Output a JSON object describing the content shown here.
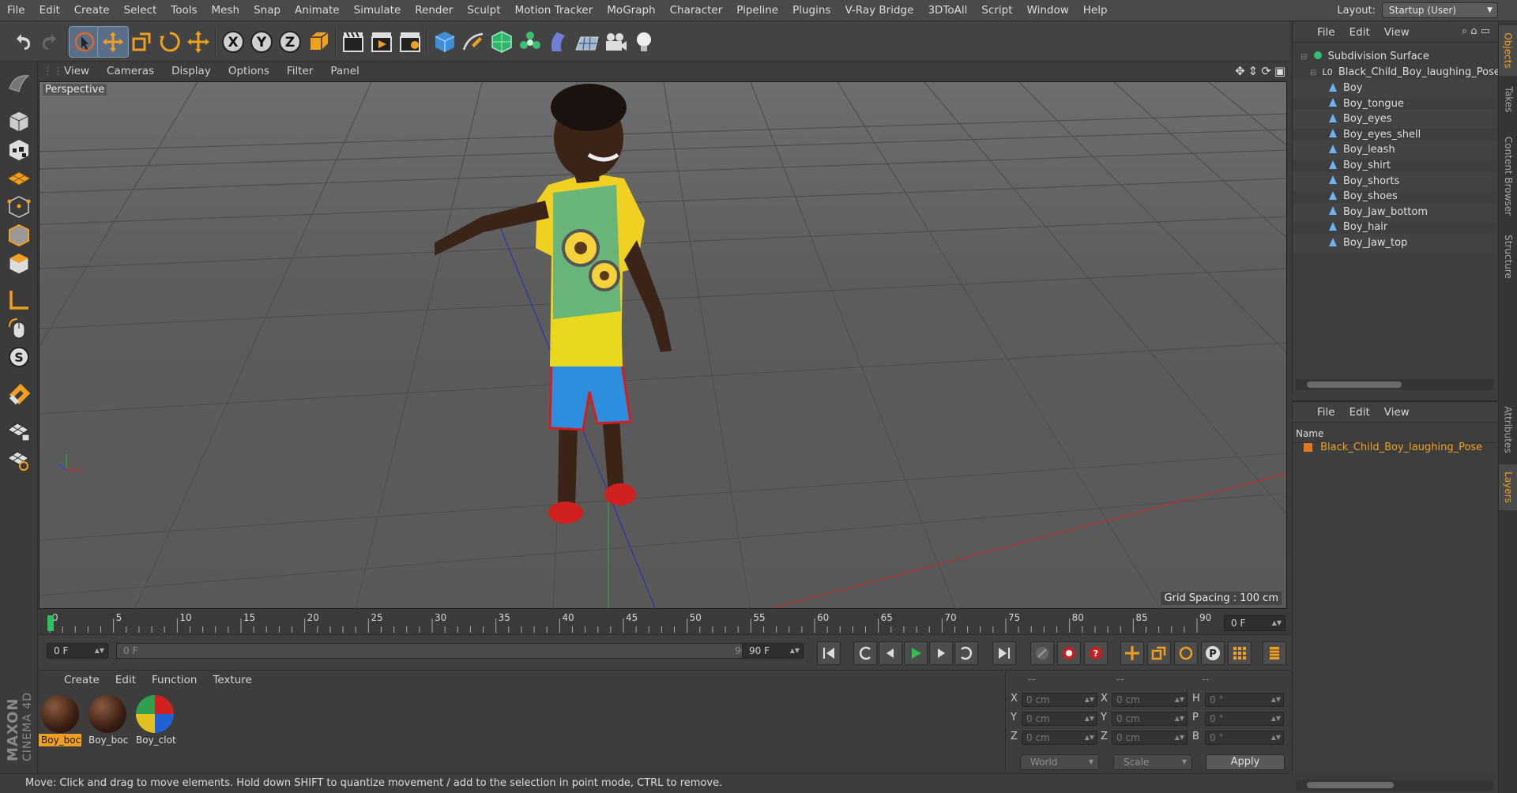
{
  "menubar": {
    "items": [
      "File",
      "Edit",
      "Create",
      "Select",
      "Tools",
      "Mesh",
      "Snap",
      "Animate",
      "Simulate",
      "Render",
      "Sculpt",
      "Motion Tracker",
      "MoGraph",
      "Character",
      "Pipeline",
      "Plugins",
      "V-Ray Bridge",
      "3DToAll",
      "Script",
      "Window",
      "Help"
    ],
    "layout_label": "Layout:",
    "layout_value": "Startup (User)"
  },
  "toolbar": {
    "icons": [
      "undo-icon",
      "redo-icon",
      "live-selection-icon",
      "move-icon",
      "scale-icon",
      "rotate-icon",
      "recent-tool-icon",
      "x-axis-lock-icon",
      "y-axis-lock-icon",
      "z-axis-lock-icon",
      "coordinate-system-icon",
      "render-view-icon",
      "render-picture-viewer-icon",
      "edit-render-settings-icon",
      "cube-primitive-icon",
      "pen-spline-icon",
      "subdivision-surface-icon",
      "cloner-icon",
      "deformer-icon",
      "floor-icon",
      "camera-icon",
      "light-icon"
    ],
    "x_label": "X",
    "y_label": "Y",
    "z_label": "Z"
  },
  "viewport": {
    "menu": [
      "View",
      "Cameras",
      "Display",
      "Options",
      "Filter",
      "Panel"
    ],
    "label": "Perspective",
    "grid_spacing": "Grid Spacing : 100 cm"
  },
  "timeline": {
    "ticks": [
      "0",
      "5",
      "10",
      "15",
      "20",
      "25",
      "30",
      "35",
      "40",
      "45",
      "50",
      "55",
      "60",
      "65",
      "70",
      "75",
      "80",
      "85",
      "90"
    ],
    "current_frame_display": "0 F"
  },
  "frames": {
    "start": "0 F",
    "slider_left": "0 F",
    "slider_right": "90 F",
    "end": "90 F"
  },
  "materials": {
    "menu": [
      "Create",
      "Edit",
      "Function",
      "Texture"
    ],
    "items": [
      {
        "label": "Boy_boc"
      },
      {
        "label": "Boy_boc"
      },
      {
        "label": "Boy_clot"
      }
    ]
  },
  "coordinates": {
    "header": [
      "--",
      "--",
      "--"
    ],
    "rows": [
      {
        "axis": "X",
        "pos": "0 cm",
        "size_axis": "X",
        "size": "0 cm",
        "rot_axis": "H",
        "rot": "0 °"
      },
      {
        "axis": "Y",
        "pos": "0 cm",
        "size_axis": "Y",
        "size": "0 cm",
        "rot_axis": "P",
        "rot": "0 °"
      },
      {
        "axis": "Z",
        "pos": "0 cm",
        "size_axis": "Z",
        "size": "0 cm",
        "rot_axis": "B",
        "rot": "0 °"
      }
    ],
    "mode1": "World",
    "mode2": "Scale",
    "apply": "Apply"
  },
  "status": "Move: Click and drag to move elements. Hold down SHIFT to quantize movement / add to the selection in point mode, CTRL to remove.",
  "objects": {
    "menu": [
      "File",
      "Edit",
      "View"
    ],
    "root": "Subdivision Surface",
    "parent": "Black_Child_Boy_laughing_Pose",
    "children": [
      "Boy",
      "Boy_tongue",
      "Boy_eyes",
      "Boy_eyes_shell",
      "Boy_leash",
      "Boy_shirt",
      "Boy_shorts",
      "Boy_shoes",
      "Boy_Jaw_bottom",
      "Boy_hair",
      "Boy_Jaw_top"
    ]
  },
  "layers": {
    "menu": [
      "File",
      "Edit",
      "View"
    ],
    "column": "Name",
    "item": "Black_Child_Boy_laughing_Pose",
    "item_color": "#e07a20"
  },
  "side_tabs": [
    "Objects",
    "Takes",
    "Content Browser",
    "Structure",
    "Attributes",
    "Layers"
  ],
  "brand": {
    "line1": "MAXON",
    "line2": "CINEMA 4D"
  },
  "colors": {
    "accent_blue": "#5a6e88",
    "highlight_orange": "#f0a020",
    "selected_label": "#f0a020"
  }
}
